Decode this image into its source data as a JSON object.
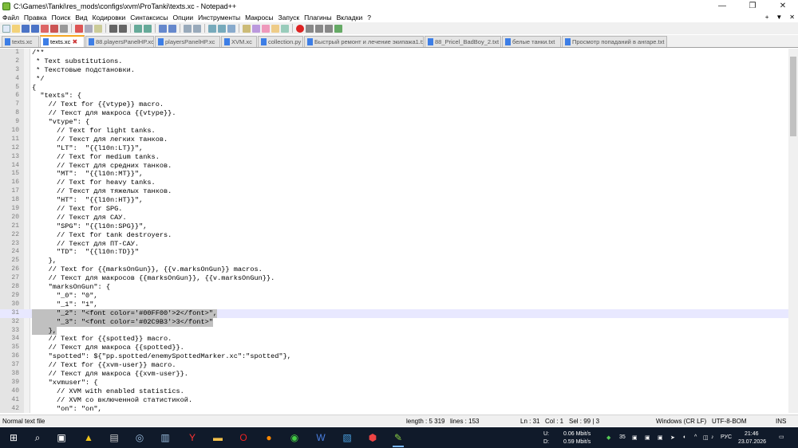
{
  "window": {
    "title": "C:\\Games\\Tanki\\res_mods\\configs\\xvm\\ProTanki\\texts.xc - Notepad++",
    "controls": [
      "—",
      "❐",
      "✕"
    ]
  },
  "menu": [
    "Файл",
    "Правка",
    "Поиск",
    "Вид",
    "Кодировки",
    "Синтаксисы",
    "Опции",
    "Инструменты",
    "Макросы",
    "Запуск",
    "Плагины",
    "Вкладки",
    "?"
  ],
  "menu_right": [
    "+",
    "▼",
    "✕"
  ],
  "tabs": [
    {
      "label": "texts.xc",
      "active": false
    },
    {
      "label": "texts.xc",
      "active": true
    },
    {
      "label": "88.playersPanelHP.xc",
      "active": false
    },
    {
      "label": "playersPanelHP.xc",
      "active": false
    },
    {
      "label": "XVM.xc",
      "active": false
    },
    {
      "label": "collection.py",
      "active": false
    },
    {
      "label": "Быстрый ремонт и лечение экипажа1.txt",
      "active": false
    },
    {
      "label": "88_Pricel_BadBoy_2.txt",
      "active": false
    },
    {
      "label": "белые танки.txt",
      "active": false
    },
    {
      "label": "Просмотр попаданий в ангаре.txt",
      "active": false
    }
  ],
  "editor": {
    "lines": [
      "/**",
      " * Text substitutions.",
      " * Текстовые подстановки.",
      " */",
      "{",
      "  \"texts\": {",
      "    // Text for {{vtype}} macro.",
      "    // Текст для макроса {{vtype}}.",
      "    \"vtype\": {",
      "      // Text for light tanks.",
      "      // Текст для легких танков.",
      "      \"LT\":  \"{{l10n:LT}}\",",
      "      // Text for medium tanks.",
      "      // Текст для средних танков.",
      "      \"MT\":  \"{{l10n:MT}}\",",
      "      // Text for heavy tanks.",
      "      // Текст для тяжелых танков.",
      "      \"HT\":  \"{{l10n:HT}}\",",
      "      // Text for SPG.",
      "      // Текст для САУ.",
      "      \"SPG\": \"{{l10n:SPG}}\",",
      "      // Text for tank destroyers.",
      "      // Текст для ПТ-САУ.",
      "      \"TD\":  \"{{l10n:TD}}\"",
      "    },",
      "    // Text for {{marksOnGun}}, {{v.marksOnGun}} macros.",
      "    // Текст для макросов {{marksOnGun}}, {{v.marksOnGun}}.",
      "    \"marksOnGun\": {",
      "      \"_0\": \"0\",",
      "      \"_1\": \"1\",",
      "      \"_2\": \"<font color='#00FF00'>2</font>\",",
      "      \"_3\": \"<font color='#02C9B3'>3</font>\"",
      "    },",
      "    // Text for {{spotted}} macro.",
      "    // Текст для макроса {{spotted}}.",
      "    \"spotted\": ${\"pp.spotted/enemySpottedMarker.xc\":\"spotted\"},",
      "    // Text for {{xvm-user}} macro.",
      "    // Текст для макроса {{xvm-user}}.",
      "    \"xvmuser\": {",
      "      // XVM with enabled statistics.",
      "      // XVM со включенной статистикой.",
      "      \"on\": \"on\","
    ]
  },
  "status": {
    "type": "Normal text file",
    "length": "length : 5 319",
    "lines": "lines : 153",
    "ln": "Ln : 31",
    "col": "Col : 1",
    "sel": "Sel : 99 | 3",
    "eol": "Windows (CR LF)",
    "encoding": "UTF-8-BOM",
    "mode": "INS"
  },
  "taskbar": {
    "upload_label": "U:",
    "download_label": "D:",
    "upload": "0.06 Mbit/s",
    "download": "0.59 Mbit/s",
    "tray_number": "35",
    "language": "РУС",
    "time": "21:46",
    "date": "23.07.2026"
  },
  "colors": {
    "selection": "#c0c0c0",
    "current_line": "#e8e8ff",
    "active_tab_accent": "#f5a623",
    "taskbar": "#101a2a"
  }
}
